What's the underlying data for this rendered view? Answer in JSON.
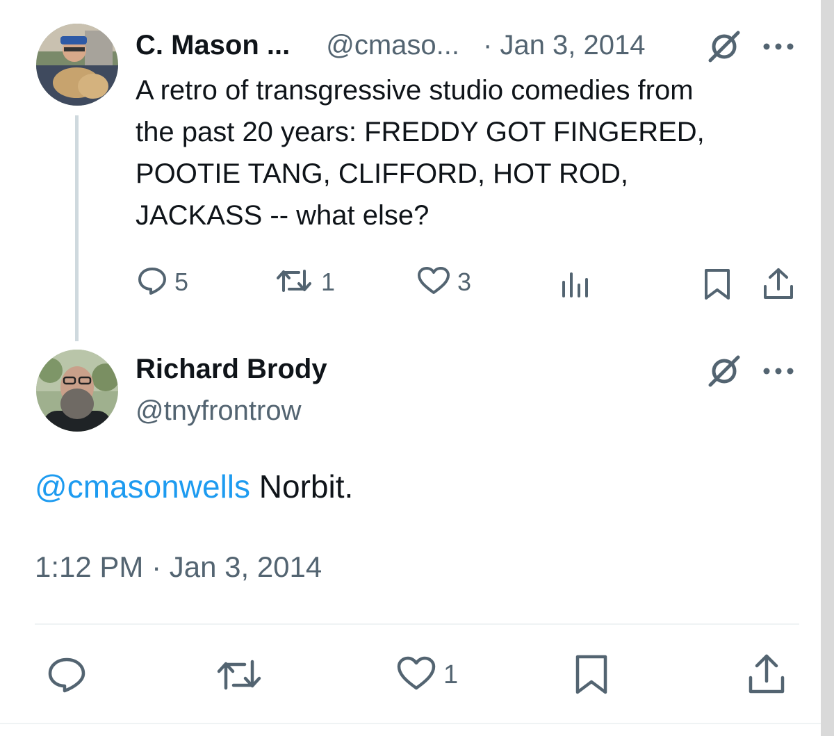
{
  "parent_tweet": {
    "display_name": "C. Mason ...",
    "handle": "@cmaso...",
    "date": "· Jan 3, 2014",
    "more_label": "···",
    "text": "A retro of transgressive studio comedies from the past 20 years: FREDDY GOT FINGERED, POOTIE TANG, CLIFFORD, HOT ROD, JACKASS -- what else?",
    "text_lines": [
      "A retro of transgressive studio comedies from",
      "the past 20 years: FREDDY GOT FINGERED,",
      "POOTIE TANG, CLIFFORD, HOT ROD,",
      "JACKASS -- what else?"
    ],
    "actions": {
      "reply_count": "5",
      "repost_count": "1",
      "like_count": "3"
    },
    "icons": [
      "no-verification-icon",
      "more-icon",
      "reply-icon",
      "repost-icon",
      "like-icon",
      "views-icon",
      "bookmark-icon",
      "share-icon"
    ]
  },
  "main_tweet": {
    "display_name": "Richard Brody",
    "handle": "@tnyfrontrow",
    "more_label": "···",
    "mention": "@cmasonwells",
    "text": " Norbit.",
    "timestamp": "1:12 PM · Jan 3, 2014",
    "actions": {
      "like_count": "1"
    },
    "icons": [
      "no-verification-icon",
      "more-icon",
      "reply-icon",
      "repost-icon",
      "like-icon",
      "bookmark-icon",
      "share-icon"
    ]
  },
  "colors": {
    "text": "#0f1419",
    "muted": "#536471",
    "link": "#1d9bf0",
    "thread_line": "#cfd9de",
    "divider": "#eff3f4"
  }
}
